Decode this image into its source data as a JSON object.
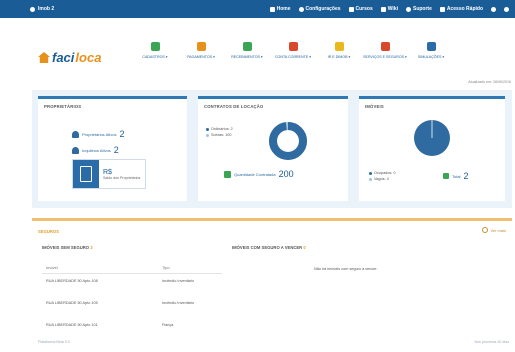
{
  "topbar": {
    "user": "Imob 2",
    "links": [
      {
        "label": "Home",
        "icon": "home-icon"
      },
      {
        "label": "Configurações",
        "icon": "gear-icon"
      },
      {
        "label": "Cursos",
        "icon": "monitor-icon"
      },
      {
        "label": "Wiki",
        "icon": "book-icon"
      },
      {
        "label": "Suporte",
        "icon": "support-icon"
      },
      {
        "label": "Acesso Rápido",
        "icon": "key-icon"
      }
    ]
  },
  "logo": {
    "part1": "faci",
    "part2": "loca"
  },
  "nav": [
    {
      "label": "CADASTROS ▾",
      "color": "#3aa655"
    },
    {
      "label": "PAGAMENTOS ▾",
      "color": "#e8901c"
    },
    {
      "label": "RECEBIMENTOS ▾",
      "color": "#3aa655"
    },
    {
      "label": "CONTA CORRENTE ▾",
      "color": "#d9482b"
    },
    {
      "label": "IR E DIMOB ▾",
      "color": "#e8b81c"
    },
    {
      "label": "SERVIÇOS E SEGUROS ▾",
      "color": "#d9482b"
    },
    {
      "label": "SIMULAÇÕES ▾",
      "color": "#2a6ca8"
    }
  ],
  "last_access": "Atualizado em: 28/06/2016",
  "panels": {
    "owners": {
      "title": "PROPRIETÁRIOS",
      "owners_label": "Proprietários Ativos",
      "owners_count": "2",
      "tenants_label": "Inquilinos Ativos",
      "tenants_count": "2",
      "balance_value": "R$",
      "balance_label": "Saldo dos Proprietários"
    },
    "contracts": {
      "title": "CONTRATOS DE LOCAÇÃO",
      "legend": [
        {
          "label": "Ordinários: 2",
          "color": "#2f6aa0"
        },
        {
          "label": "Sobras: 100",
          "color": "#9fc3e0"
        }
      ],
      "total_label": "Quantidade Contratada",
      "total_value": "200",
      "donut_fraction": 0.98
    },
    "properties": {
      "title": "IMÓVEIS",
      "legend": [
        {
          "label": "Ocupados: 0",
          "color": "#2f6aa0"
        },
        {
          "label": "Vagos: 4",
          "color": "#9fc3e0"
        }
      ],
      "total_label": "Total",
      "total_value": "2"
    }
  },
  "insurance": {
    "title": "SEGUROS",
    "see_all": "Ver mais",
    "without": {
      "title": "IMÓVEIS SEM SEGURO",
      "count": "3",
      "col_property": "Imóvel",
      "col_type": "Tipo",
      "rows": [
        {
          "property": "RUA LIBERDADE 50 Apto 108",
          "type": "Incêndio Inventário"
        },
        {
          "property": "RUA LIBERDADE 50 Apto 105",
          "type": "Incêndio Inventário"
        },
        {
          "property": "RUA LIBERDADE 50 Apto 101",
          "type": "Fiança"
        }
      ]
    },
    "with": {
      "title": "IMÓVEIS COM SEGURO A VENCER",
      "count": "0",
      "empty": "Não há imóveis com seguro a vencer."
    }
  },
  "footer": {
    "left": "Plataforma Beta 3.0",
    "right": "Nos próximos 30 dias"
  }
}
